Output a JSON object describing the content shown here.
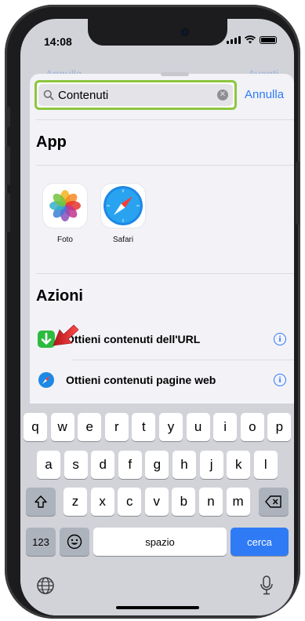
{
  "status_bar": {
    "time": "14:08"
  },
  "background": {
    "left_action": "Annulla",
    "right_action": "Avanti"
  },
  "search": {
    "value": "Contenuti",
    "cancel_label": "Annulla"
  },
  "sections": {
    "apps_title": "App",
    "actions_title": "Azioni"
  },
  "apps": [
    {
      "label": "Foto",
      "icon": "photos-icon"
    },
    {
      "label": "Safari",
      "icon": "safari-icon"
    }
  ],
  "actions": [
    {
      "label": "Ottieni contenuti dell'URL",
      "icon": "download-arrow-icon",
      "icon_color": "#2dbb3f"
    },
    {
      "label": "Ottieni contenuti pagine web",
      "icon": "safari-icon",
      "icon_color": "#1e88e5"
    }
  ],
  "keyboard": {
    "row1": [
      "q",
      "w",
      "e",
      "r",
      "t",
      "y",
      "u",
      "i",
      "o",
      "p"
    ],
    "row2": [
      "a",
      "s",
      "d",
      "f",
      "g",
      "h",
      "j",
      "k",
      "l"
    ],
    "row3": [
      "z",
      "x",
      "c",
      "v",
      "b",
      "n",
      "m"
    ],
    "numbers_label": "123",
    "space_label": "spazio",
    "return_label": "cerca"
  },
  "colors": {
    "accent": "#2f7bf6",
    "highlight": "#8cc63f",
    "annotation_arrow": "#e31e24"
  }
}
